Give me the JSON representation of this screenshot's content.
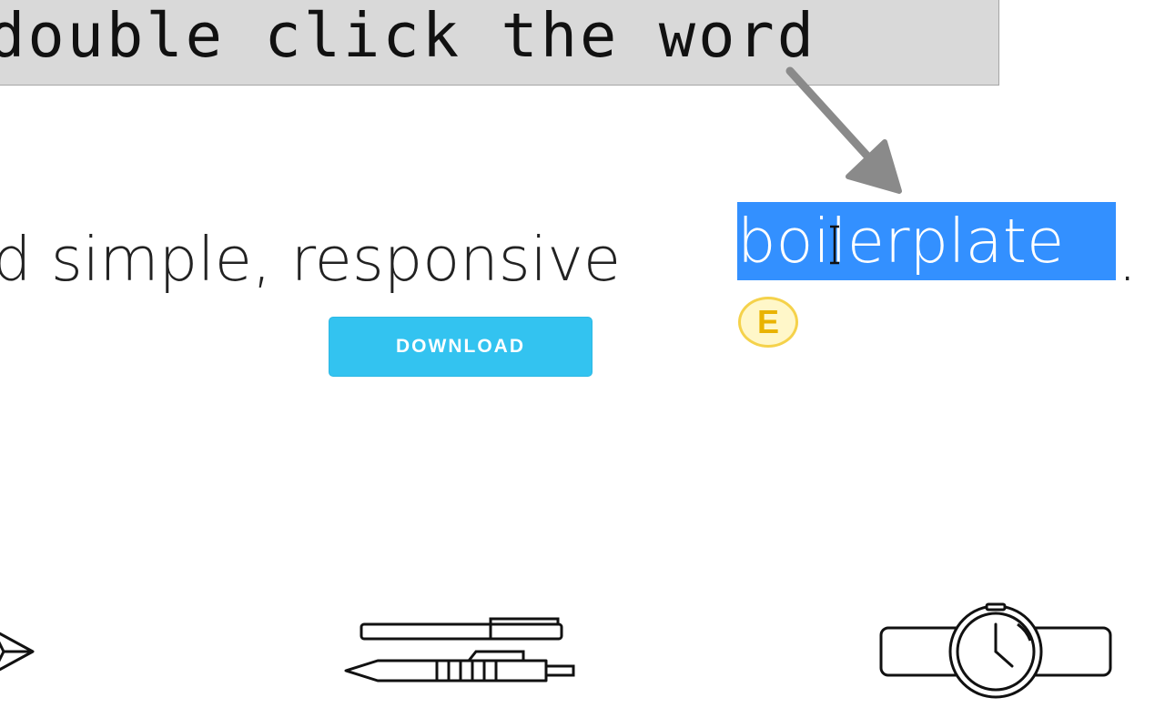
{
  "instruction": {
    "text": "double click the word"
  },
  "hero": {
    "text_before": "d simple, responsive ",
    "selected_word": "boilerplate",
    "text_after": "."
  },
  "download_button": {
    "label": "DOWNLOAD"
  },
  "extension_badge": {
    "letter": "E"
  },
  "icons": {
    "instruction_arrow": "arrow-icon",
    "text_cursor": "i-beam-cursor-icon",
    "feature_1": "paper-plane-icon",
    "feature_2": "pens-icon",
    "feature_3": "watch-icon"
  },
  "colors": {
    "selection": "#3390ff",
    "button": "#33c3f0",
    "badge": "#f5d24b"
  }
}
